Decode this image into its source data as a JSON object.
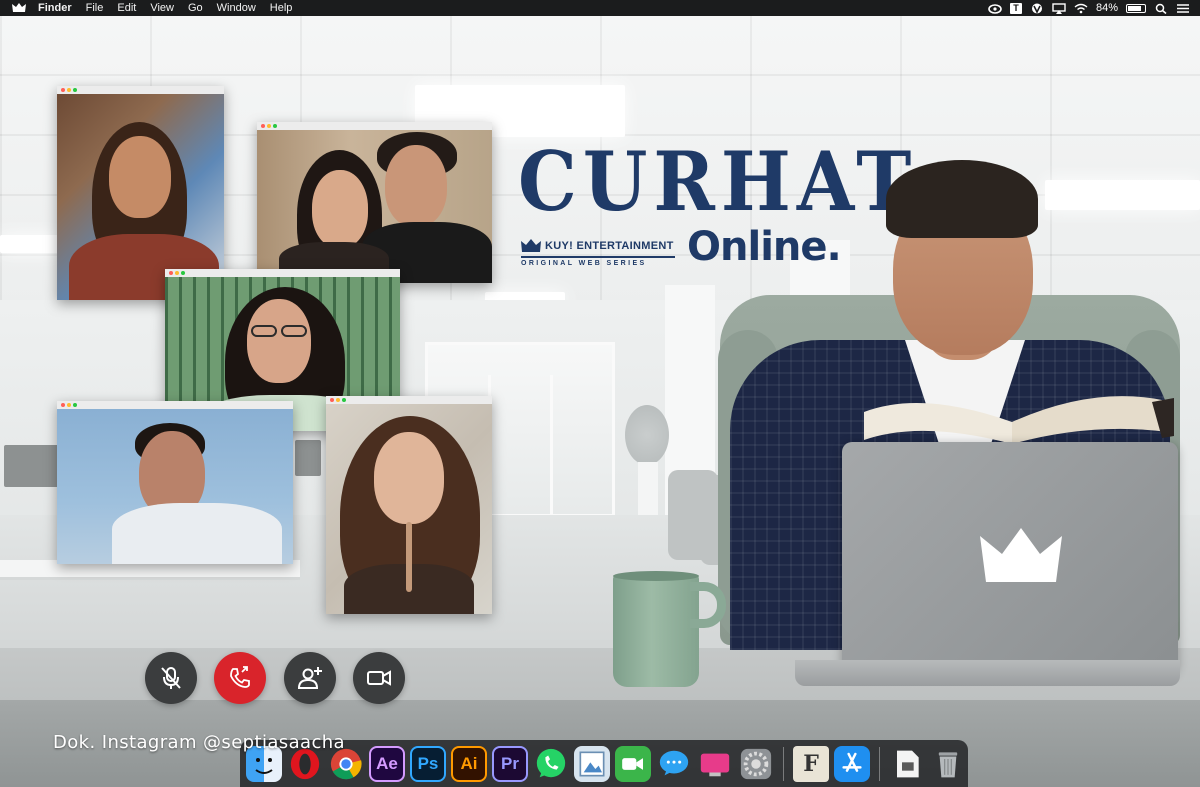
{
  "menubar": {
    "app_name": "Finder",
    "menus": [
      "File",
      "Edit",
      "View",
      "Go",
      "Window",
      "Help"
    ],
    "battery_text": "84%",
    "battery_level": 0.84,
    "status_icons": [
      "creative-cloud-icon",
      "typora-t-icon",
      "vpn-icon",
      "airplay-icon",
      "wifi-icon",
      "battery-icon",
      "search-icon",
      "control-center-icon"
    ]
  },
  "title": {
    "main": "CURHAT",
    "sub": "Online.",
    "brand": "KUY! ENTERTAINMENT",
    "tagline": "ORIGINAL WEB SERIES"
  },
  "call_controls": [
    "mute-microphone",
    "end-call",
    "add-participant",
    "video-camera"
  ],
  "caption": "Dok. Instagram @septiasaacha",
  "dock": {
    "apps": [
      "Finder",
      "Opera",
      "Chrome",
      "Ae",
      "Ps",
      "Ai",
      "Pr",
      "WhatsApp",
      "Preview",
      "FaceTime",
      "Messages",
      "CleanMyMac",
      "System Preferences",
      "F",
      "App Store",
      "Document",
      "Trash"
    ]
  },
  "colors": {
    "brand_navy": "#1f3a67",
    "end_call_red": "#d9242b",
    "menubar_bg": "#1b1c1d"
  }
}
